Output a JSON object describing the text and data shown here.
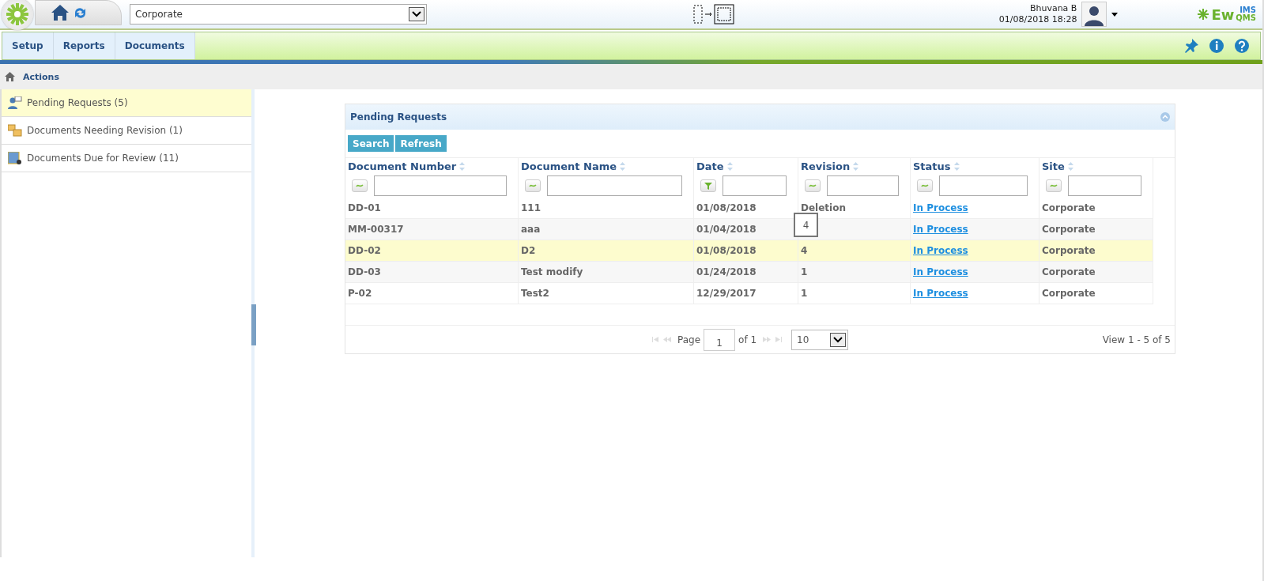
{
  "header": {
    "site_select": "Corporate",
    "user_name": "Bhuvana B",
    "datetime": "01/08/2018 18:28",
    "brand": {
      "main": "Ew",
      "sub": "QMS",
      "top": "IMS"
    }
  },
  "menu": [
    {
      "label": "Setup"
    },
    {
      "label": "Reports"
    },
    {
      "label": "Documents"
    }
  ],
  "breadcrumb": {
    "label": "Actions"
  },
  "sidebar": {
    "items": [
      {
        "label": "Pending Requests (5)",
        "selected": true,
        "kind": "requests"
      },
      {
        "label": "Documents Needing Revision (1)",
        "selected": false,
        "kind": "revision"
      },
      {
        "label": "Documents Due for Review (11)",
        "selected": false,
        "kind": "review"
      }
    ]
  },
  "panel": {
    "title": "Pending Requests",
    "buttons": [
      "Search",
      "Refresh"
    ],
    "columns": [
      {
        "label": "Document Number",
        "kind": "text"
      },
      {
        "label": "Document Name",
        "kind": "text"
      },
      {
        "label": "Date",
        "kind": "date"
      },
      {
        "label": "Revision",
        "kind": "text"
      },
      {
        "label": "Status",
        "kind": "text"
      },
      {
        "label": "Site",
        "kind": "text"
      }
    ],
    "rows": [
      {
        "number": "DD-01",
        "name": "111",
        "date": "01/08/2018",
        "revision": "Deletion",
        "status": "In Process",
        "site": "Corporate",
        "selected": false
      },
      {
        "number": "MM-00317",
        "name": "aaa",
        "date": "01/04/2018",
        "status": "In Process",
        "site": "Corporate",
        "selected": false
      },
      {
        "number": "DD-02",
        "name": "D2",
        "date": "01/08/2018",
        "revision": "4",
        "status": "In Process",
        "site": "Corporate",
        "selected": true
      },
      {
        "number": "DD-03",
        "name": "Test modify",
        "date": "01/24/2018",
        "revision": "1",
        "status": "In Process",
        "site": "Corporate",
        "selected": false
      },
      {
        "number": "P-02",
        "name": "Test2",
        "date": "12/29/2017",
        "revision": "1",
        "status": "In Process",
        "site": "Corporate",
        "selected": false
      }
    ],
    "tooltip": "4",
    "pager": {
      "page_label": "Page",
      "page": "1",
      "of": "of 1",
      "page_size": "10",
      "view": "View 1 - 5 of 5"
    }
  }
}
